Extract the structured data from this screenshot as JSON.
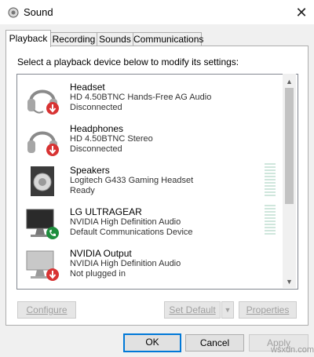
{
  "window": {
    "title": "Sound"
  },
  "tabs": [
    {
      "label": "Playback"
    },
    {
      "label": "Recording"
    },
    {
      "label": "Sounds"
    },
    {
      "label": "Communications"
    }
  ],
  "instruction": "Select a playback device below to modify its settings:",
  "devices": [
    {
      "name": "Headset",
      "driver": "HD 4.50BTNC Hands-Free AG Audio",
      "status": "Disconnected",
      "icon": "headset-icon"
    },
    {
      "name": "Headphones",
      "driver": "HD 4.50BTNC Stereo",
      "status": "Disconnected",
      "icon": "headphones-icon"
    },
    {
      "name": "Speakers",
      "driver": "Logitech G433 Gaming Headset",
      "status": "Ready",
      "icon": "speaker-icon"
    },
    {
      "name": "LG ULTRAGEAR",
      "driver": "NVIDIA High Definition Audio",
      "status": "Default Communications Device",
      "icon": "monitor-icon"
    },
    {
      "name": "NVIDIA Output",
      "driver": "NVIDIA High Definition Audio",
      "status": "Not plugged in",
      "icon": "monitor-icon"
    }
  ],
  "buttons": {
    "configure": "Configure",
    "set_default": "Set Default",
    "properties": "Properties",
    "ok": "OK",
    "cancel": "Cancel",
    "apply": "Apply"
  },
  "watermark": "wsxdn.com"
}
